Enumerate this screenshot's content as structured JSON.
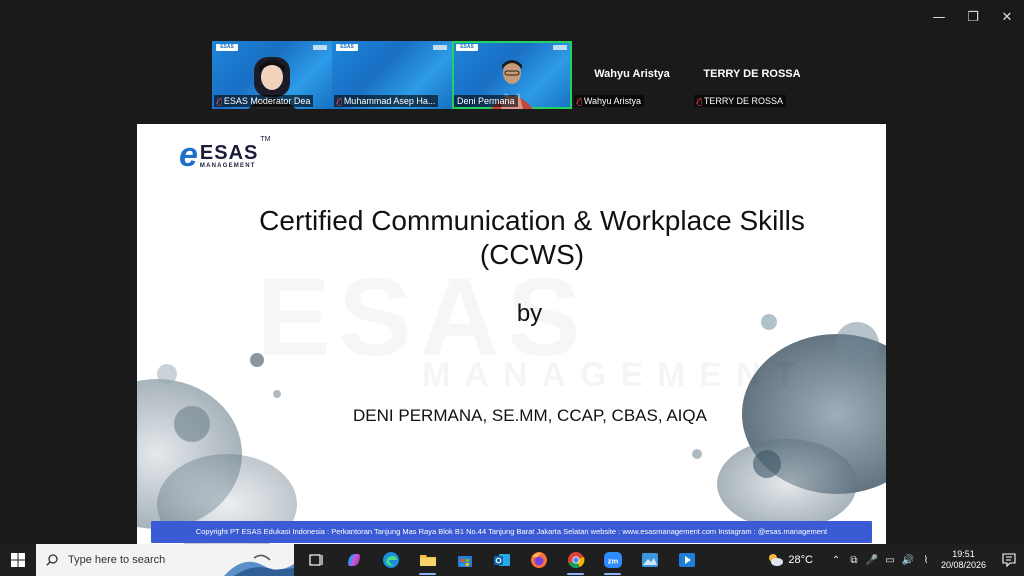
{
  "window": {
    "minimize": "—",
    "restore": "❐",
    "close": "✕"
  },
  "participants": [
    {
      "name": "ESAS Moderator Dea",
      "muted": true,
      "video": true,
      "active": false
    },
    {
      "name": "Muhammad Asep Ha...",
      "muted": true,
      "video": true,
      "active": false
    },
    {
      "name": "Deni Permana",
      "muted": false,
      "video": true,
      "active": true
    },
    {
      "name": "Wahyu Aristya",
      "muted": true,
      "video": false,
      "active": false
    },
    {
      "name": "TERRY DE ROSSA",
      "muted": true,
      "video": false,
      "active": false
    }
  ],
  "slide": {
    "logo_text": "ESAS",
    "logo_sub": "MANAGEMENT",
    "logo_tm": "TM",
    "title_line1": "Certified Communication & Workplace Skills",
    "title_line2": "(CCWS)",
    "by": "by",
    "presenter": "DENI PERMANA, SE.MM, CCAP, CBAS, AIQA",
    "footer": "Copyright PT ESAS Edukasi Indonesia : Perkantoran Tanjung Mas Raya Blok B1 No.44 Tanjung Barat Jakarta Selatan website : www.esasmanagement.com Instagram : @esas.management"
  },
  "taskbar": {
    "search_placeholder": "Type here to search",
    "apps": [
      "task-view",
      "copilot",
      "edge",
      "file-explorer",
      "store",
      "outlook",
      "firefox",
      "chrome",
      "zoom",
      "photos",
      "media-player"
    ],
    "weather_temp": "28°C",
    "time": "19:51",
    "date": "20/08/2026"
  }
}
